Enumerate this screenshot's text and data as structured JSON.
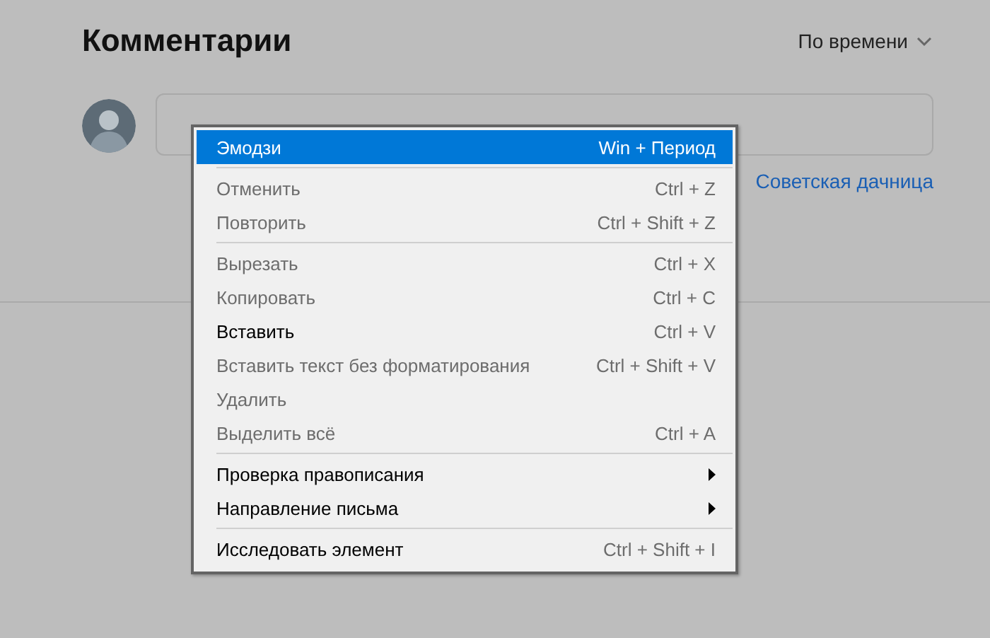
{
  "comments": {
    "title": "Комментарии",
    "sort": "По времени",
    "author_link": "Советская дачница"
  },
  "menu": {
    "items": [
      {
        "kind": "item",
        "label": "Эмодзи",
        "shortcut": "Win + Период",
        "disabled": false,
        "selected": true
      },
      {
        "kind": "separator"
      },
      {
        "kind": "item",
        "label": "Отменить",
        "shortcut": "Ctrl + Z",
        "disabled": true,
        "selected": false
      },
      {
        "kind": "item",
        "label": "Повторить",
        "shortcut": "Ctrl + Shift + Z",
        "disabled": true,
        "selected": false
      },
      {
        "kind": "separator"
      },
      {
        "kind": "item",
        "label": "Вырезать",
        "shortcut": "Ctrl + X",
        "disabled": true,
        "selected": false
      },
      {
        "kind": "item",
        "label": "Копировать",
        "shortcut": "Ctrl + C",
        "disabled": true,
        "selected": false
      },
      {
        "kind": "item",
        "label": "Вставить",
        "shortcut": "Ctrl + V",
        "disabled": false,
        "selected": false
      },
      {
        "kind": "item",
        "label": "Вставить текст без форматирования",
        "shortcut": "Ctrl + Shift + V",
        "disabled": true,
        "selected": false
      },
      {
        "kind": "item",
        "label": "Удалить",
        "disabled": true,
        "selected": false
      },
      {
        "kind": "item",
        "label": "Выделить всё",
        "shortcut": "Ctrl + A",
        "disabled": true,
        "selected": false
      },
      {
        "kind": "separator"
      },
      {
        "kind": "submenu",
        "label": "Проверка правописания",
        "disabled": false,
        "selected": false
      },
      {
        "kind": "submenu",
        "label": "Направление письма",
        "disabled": false,
        "selected": false
      },
      {
        "kind": "separator"
      },
      {
        "kind": "item",
        "label": "Исследовать элемент",
        "shortcut": "Ctrl + Shift + I",
        "disabled": false,
        "selected": false
      }
    ]
  }
}
